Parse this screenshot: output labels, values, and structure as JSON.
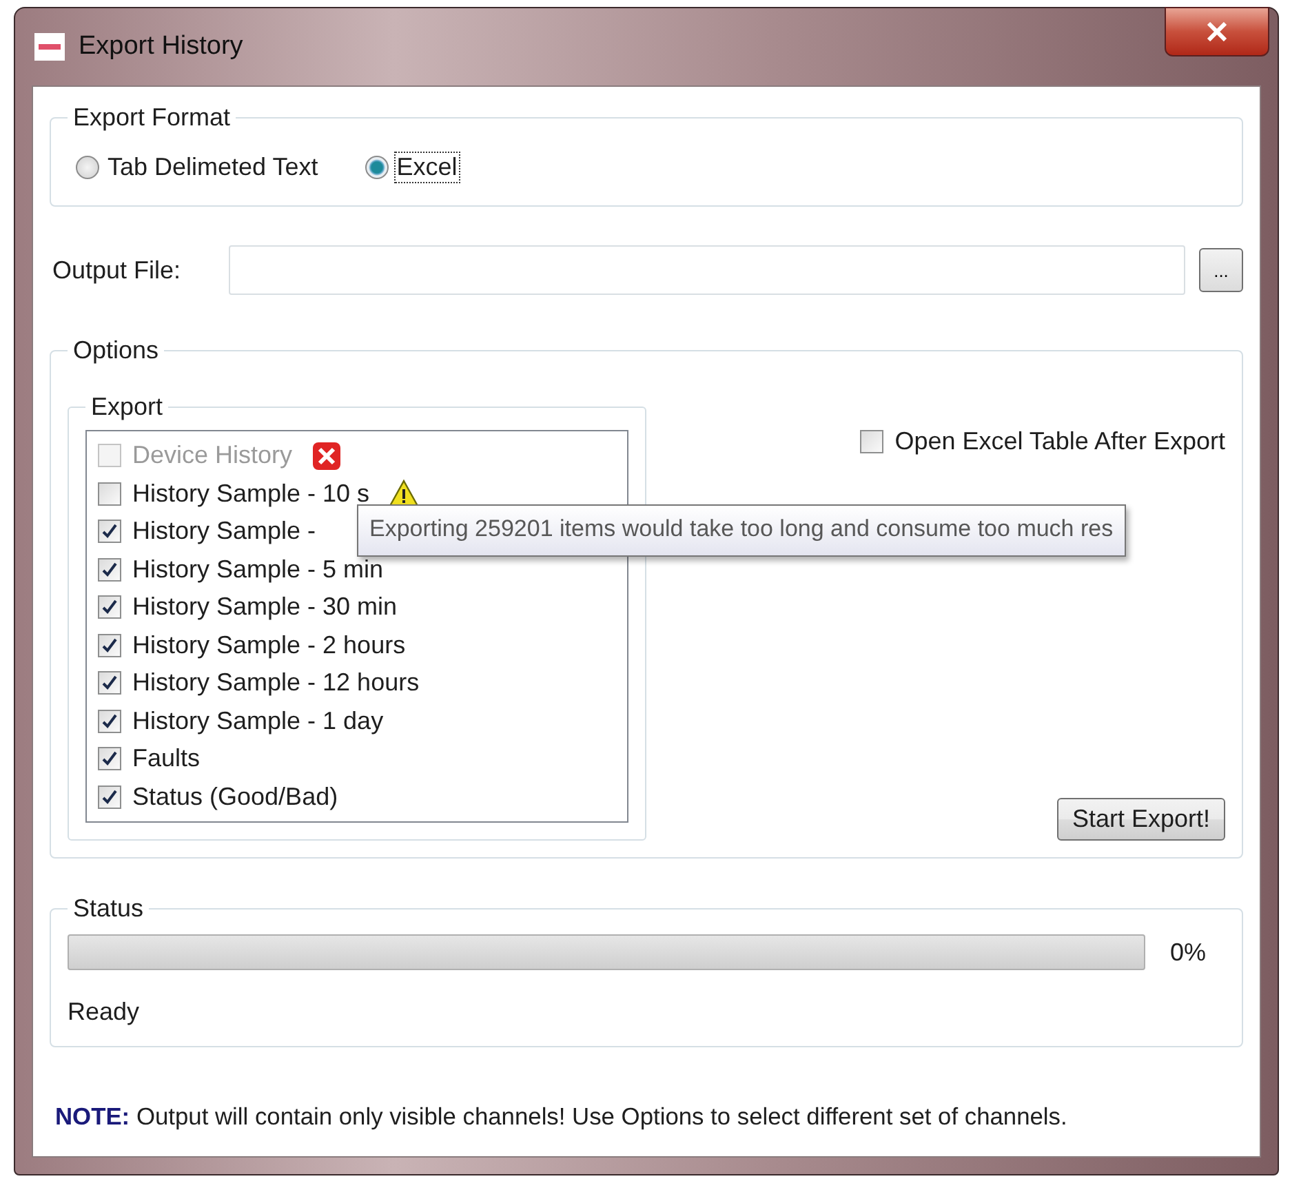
{
  "window": {
    "title": "Export History"
  },
  "export_format": {
    "title": "Export Format",
    "options": [
      {
        "label": "Tab Delimeted Text",
        "selected": false
      },
      {
        "label": "Excel",
        "selected": true
      }
    ]
  },
  "output_file": {
    "label": "Output File:",
    "browse_button": "..."
  },
  "options": {
    "title": "Options",
    "export": {
      "title": "Export",
      "items": [
        {
          "label": "Device History",
          "checked": false,
          "disabled": true,
          "kind": "error"
        },
        {
          "label": "History Sample - 10 s",
          "checked": false,
          "disabled": false,
          "kind": "warning"
        },
        {
          "label": "History Sample - ",
          "checked": true,
          "disabled": false,
          "tooltip": "Exporting 259201 items would take too long and consume too much res"
        },
        {
          "label": "History Sample - 5 min",
          "checked": true,
          "disabled": false
        },
        {
          "label": "History Sample - 30 min",
          "checked": true,
          "disabled": false
        },
        {
          "label": "History Sample - 2 hours",
          "checked": true,
          "disabled": false
        },
        {
          "label": "History Sample - 12 hours",
          "checked": true,
          "disabled": false
        },
        {
          "label": "History Sample - 1 day",
          "checked": true,
          "disabled": false
        },
        {
          "label": "Faults",
          "checked": true,
          "disabled": false
        },
        {
          "label": "Status (Good/Bad)",
          "checked": true,
          "disabled": false
        }
      ]
    },
    "open_after_export": {
      "label": "Open Excel Table After Export",
      "checked": false
    },
    "start_button": "Start Export!"
  },
  "status": {
    "title": "Status",
    "level": 0,
    "percent": "0%",
    "message": "Ready"
  },
  "note": "**NOTE:** Output will contain only visible channels! Use Options to select different set of channels."
}
